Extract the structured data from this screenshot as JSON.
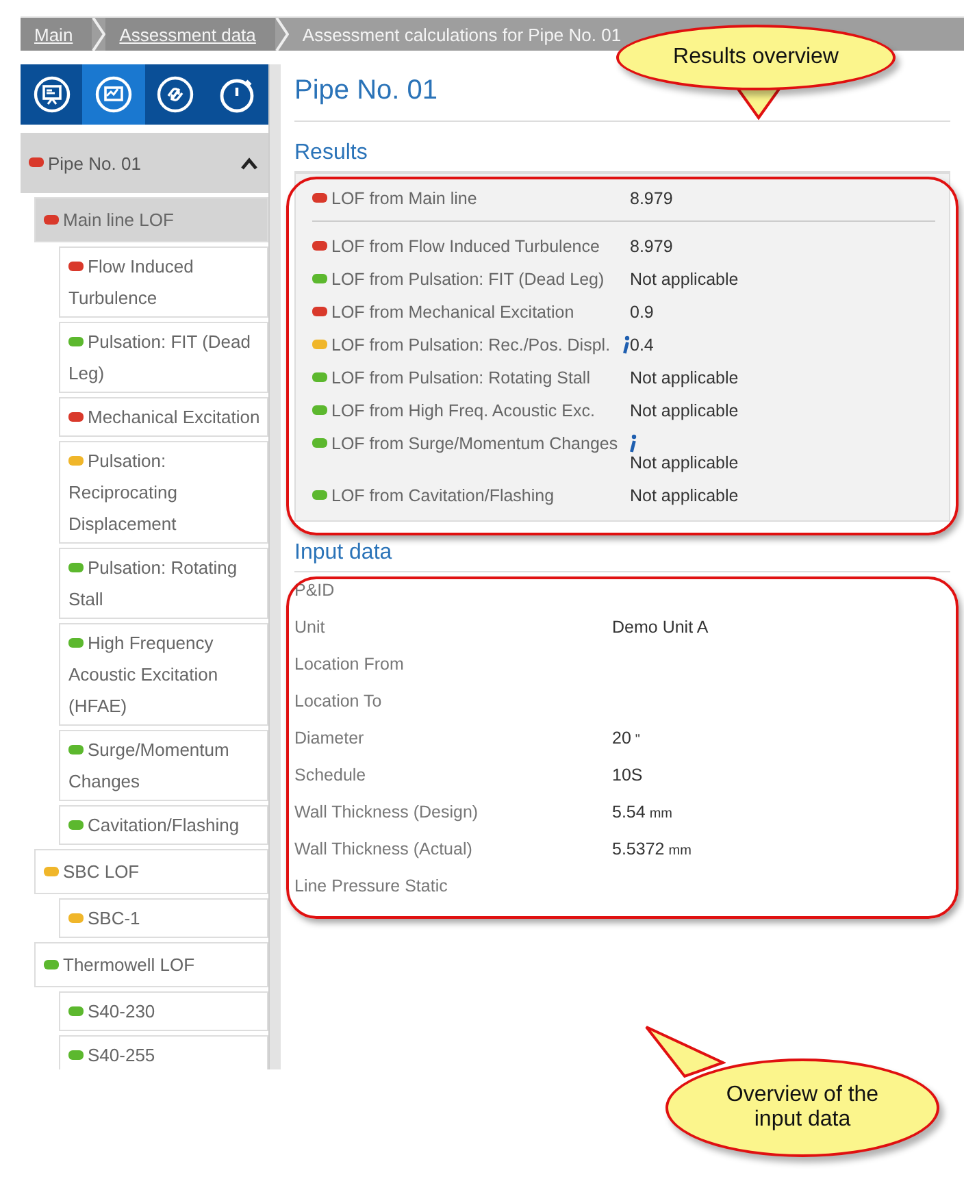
{
  "breadcrumb": [
    {
      "label": "Main",
      "kind": "link"
    },
    {
      "label": "Assessment data",
      "kind": "link"
    },
    {
      "label": "Assessment calculations for  Pipe No. 01",
      "kind": "current"
    }
  ],
  "toolbar": [
    {
      "selected": false
    },
    {
      "selected": true
    },
    {
      "selected": false
    },
    {
      "selected": false
    }
  ],
  "sidebar": {
    "root": {
      "label": "Pipe No. 01",
      "color": "#d9392b",
      "expanded": true,
      "children": [
        {
          "label": "Main line LOF",
          "color": "#d9392b",
          "selected": true,
          "children": [
            {
              "label": "Flow Induced Turbulence",
              "color": "#d9392b",
              "selected": false
            },
            {
              "label": "Pulsation: FIT (Dead Leg)",
              "color": "#5cb82e",
              "selected": false
            },
            {
              "label": "Mechanical Excitation",
              "color": "#d9392b",
              "selected": false
            },
            {
              "label": "Pulsation: Reciprocating Displacement",
              "color": "#f0b62a",
              "selected": false
            },
            {
              "label": "Pulsation: Rotating Stall",
              "color": "#5cb82e",
              "selected": false
            },
            {
              "label": "High Frequency Acoustic Excitation (HFAE)",
              "color": "#5cb82e",
              "selected": false
            },
            {
              "label": "Surge/Momentum Changes",
              "color": "#5cb82e",
              "selected": false
            },
            {
              "label": "Cavitation/Flashing",
              "color": "#5cb82e",
              "selected": false
            }
          ]
        },
        {
          "label": "SBC LOF",
          "color": "#f0b62a",
          "selected": false,
          "children": [
            {
              "label": "SBC-1",
              "color": "#f0b62a",
              "selected": false
            }
          ]
        },
        {
          "label": "Thermowell LOF",
          "color": "#5cb82e",
          "selected": false,
          "children": [
            {
              "label": "S40-230",
              "color": "#5cb82e",
              "selected": false
            },
            {
              "label": "S40-255",
              "color": "#5cb82e",
              "selected": false
            }
          ]
        }
      ]
    }
  },
  "page_title": "Pipe No. 01",
  "results": {
    "heading": "Results",
    "rows": [
      {
        "label": "LOF from Main line",
        "value": "8.979",
        "color": "#d9392b",
        "info": false,
        "divider": true
      },
      {
        "label": "LOF from Flow Induced Turbulence",
        "value": "8.979",
        "color": "#d9392b",
        "info": false,
        "divider": false
      },
      {
        "label": "LOF from Pulsation: FIT (Dead Leg)",
        "value": "Not applicable",
        "color": "#5cb82e",
        "info": false,
        "divider": false
      },
      {
        "label": "LOF from Mechanical Excitation",
        "value": "0.9",
        "color": "#d9392b",
        "info": false,
        "divider": false
      },
      {
        "label": "LOF from Pulsation: Rec./Pos. Displ.",
        "value": "0.4",
        "color": "#f0b62a",
        "info": true,
        "divider": false
      },
      {
        "label": "LOF from Pulsation: Rotating Stall",
        "value": "Not applicable",
        "color": "#5cb82e",
        "info": false,
        "divider": false
      },
      {
        "label": "LOF from High Freq. Acoustic Exc.",
        "value": "Not applicable",
        "color": "#5cb82e",
        "info": false,
        "divider": false
      },
      {
        "label": "LOF from Surge/Momentum Changes",
        "value": "Not applicable",
        "color": "#5cb82e",
        "info": true,
        "divider": false
      },
      {
        "label": "LOF from Cavitation/Flashing",
        "value": "Not applicable",
        "color": "#5cb82e",
        "info": false,
        "divider": false
      }
    ]
  },
  "input_data": {
    "heading": "Input data",
    "rows": [
      {
        "label": "P&ID"
      },
      {
        "label": "Unit",
        "value": "Demo Unit A"
      },
      {
        "label": "Location From"
      },
      {
        "label": "Location To"
      },
      {
        "label": "Diameter",
        "value": "20",
        "unit": "\""
      },
      {
        "label": "Schedule",
        "value": "10S"
      },
      {
        "label": "Wall Thickness (Design)",
        "value": "5.54",
        "unit": "mm"
      },
      {
        "label": "Wall Thickness (Actual)",
        "value": "5.5372",
        "unit": "mm"
      },
      {
        "label": "Line Pressure Static"
      }
    ]
  },
  "callouts": [
    {
      "text": "Results overview"
    },
    {
      "text": "Overview of the input data"
    }
  ]
}
